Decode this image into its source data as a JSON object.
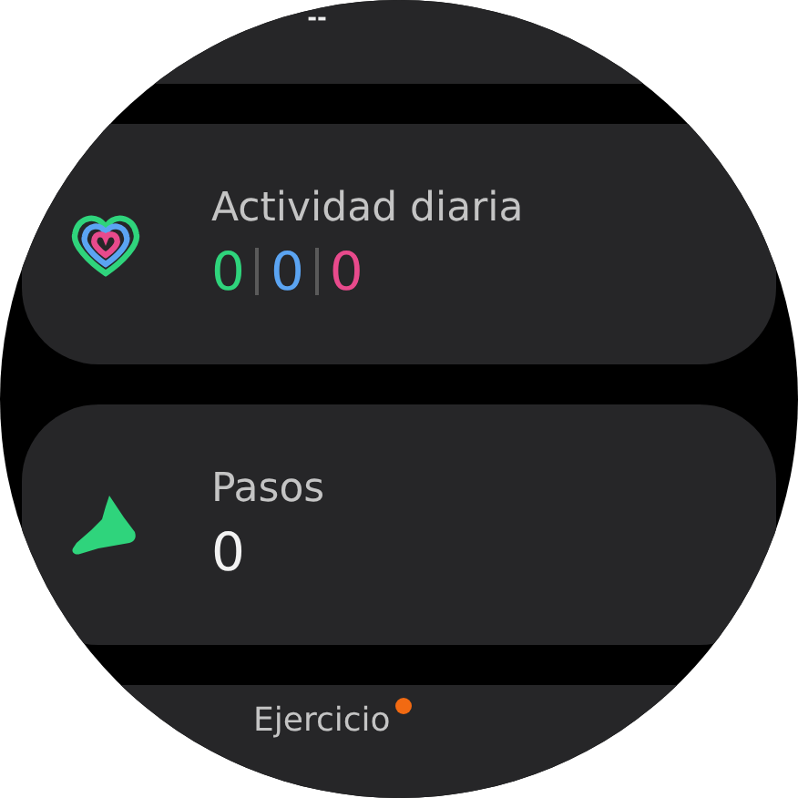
{
  "top_card": {
    "value": "--"
  },
  "tiles": [
    {
      "kind": "activity",
      "title": "Actividad diaria",
      "values": [
        {
          "text": "0",
          "color": "#2fd47c"
        },
        {
          "text": "0",
          "color": "#5ba4f2"
        },
        {
          "text": "0",
          "color": "#e84a8c"
        }
      ]
    },
    {
      "kind": "steps",
      "title": "Pasos",
      "value": "0"
    }
  ],
  "exercise": {
    "title": "Ejercicio",
    "notification": true
  }
}
